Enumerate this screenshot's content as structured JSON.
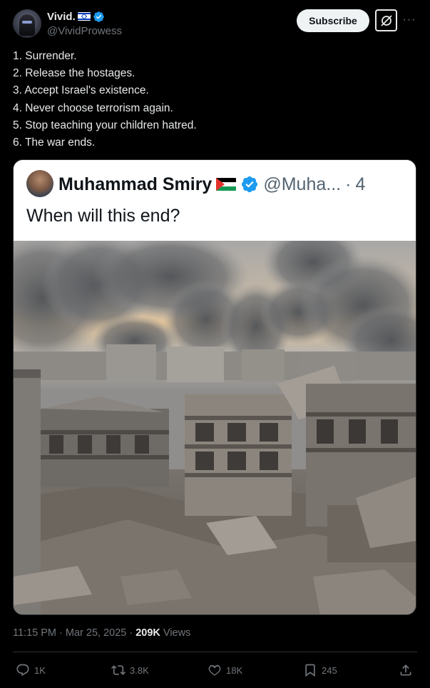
{
  "author": {
    "name": "Vivid.",
    "handle": "@VividProwess"
  },
  "header": {
    "subscribe_label": "Subscribe",
    "more_label": "···"
  },
  "tweet": {
    "lines": [
      "1. Surrender.",
      "2. Release the hostages.",
      "3. Accept Israel's existence.",
      "4. Never choose terrorism again.",
      "5. Stop teaching your children hatred.",
      "6. The war ends."
    ]
  },
  "quote": {
    "name": "Muhammad Smiry",
    "handle": "@Muha...",
    "sep": "· ",
    "time": "4",
    "text": "When will this end?"
  },
  "meta": {
    "time": "11:15 PM · Mar 25, 2025 · ",
    "views_count": "209K",
    "views_label": " Views"
  },
  "actions": {
    "replies": "1K",
    "reposts": "3.8K",
    "likes": "18K",
    "bookmarks": "245"
  },
  "colors": {
    "background": "#000000",
    "text": "#e7e9ea",
    "muted": "#71767b",
    "verified": "#1d9bf0"
  },
  "icons": [
    "verified-badge-icon",
    "grok-icon",
    "more-icon",
    "reply-icon",
    "repost-icon",
    "like-icon",
    "bookmark-icon",
    "share-icon"
  ]
}
